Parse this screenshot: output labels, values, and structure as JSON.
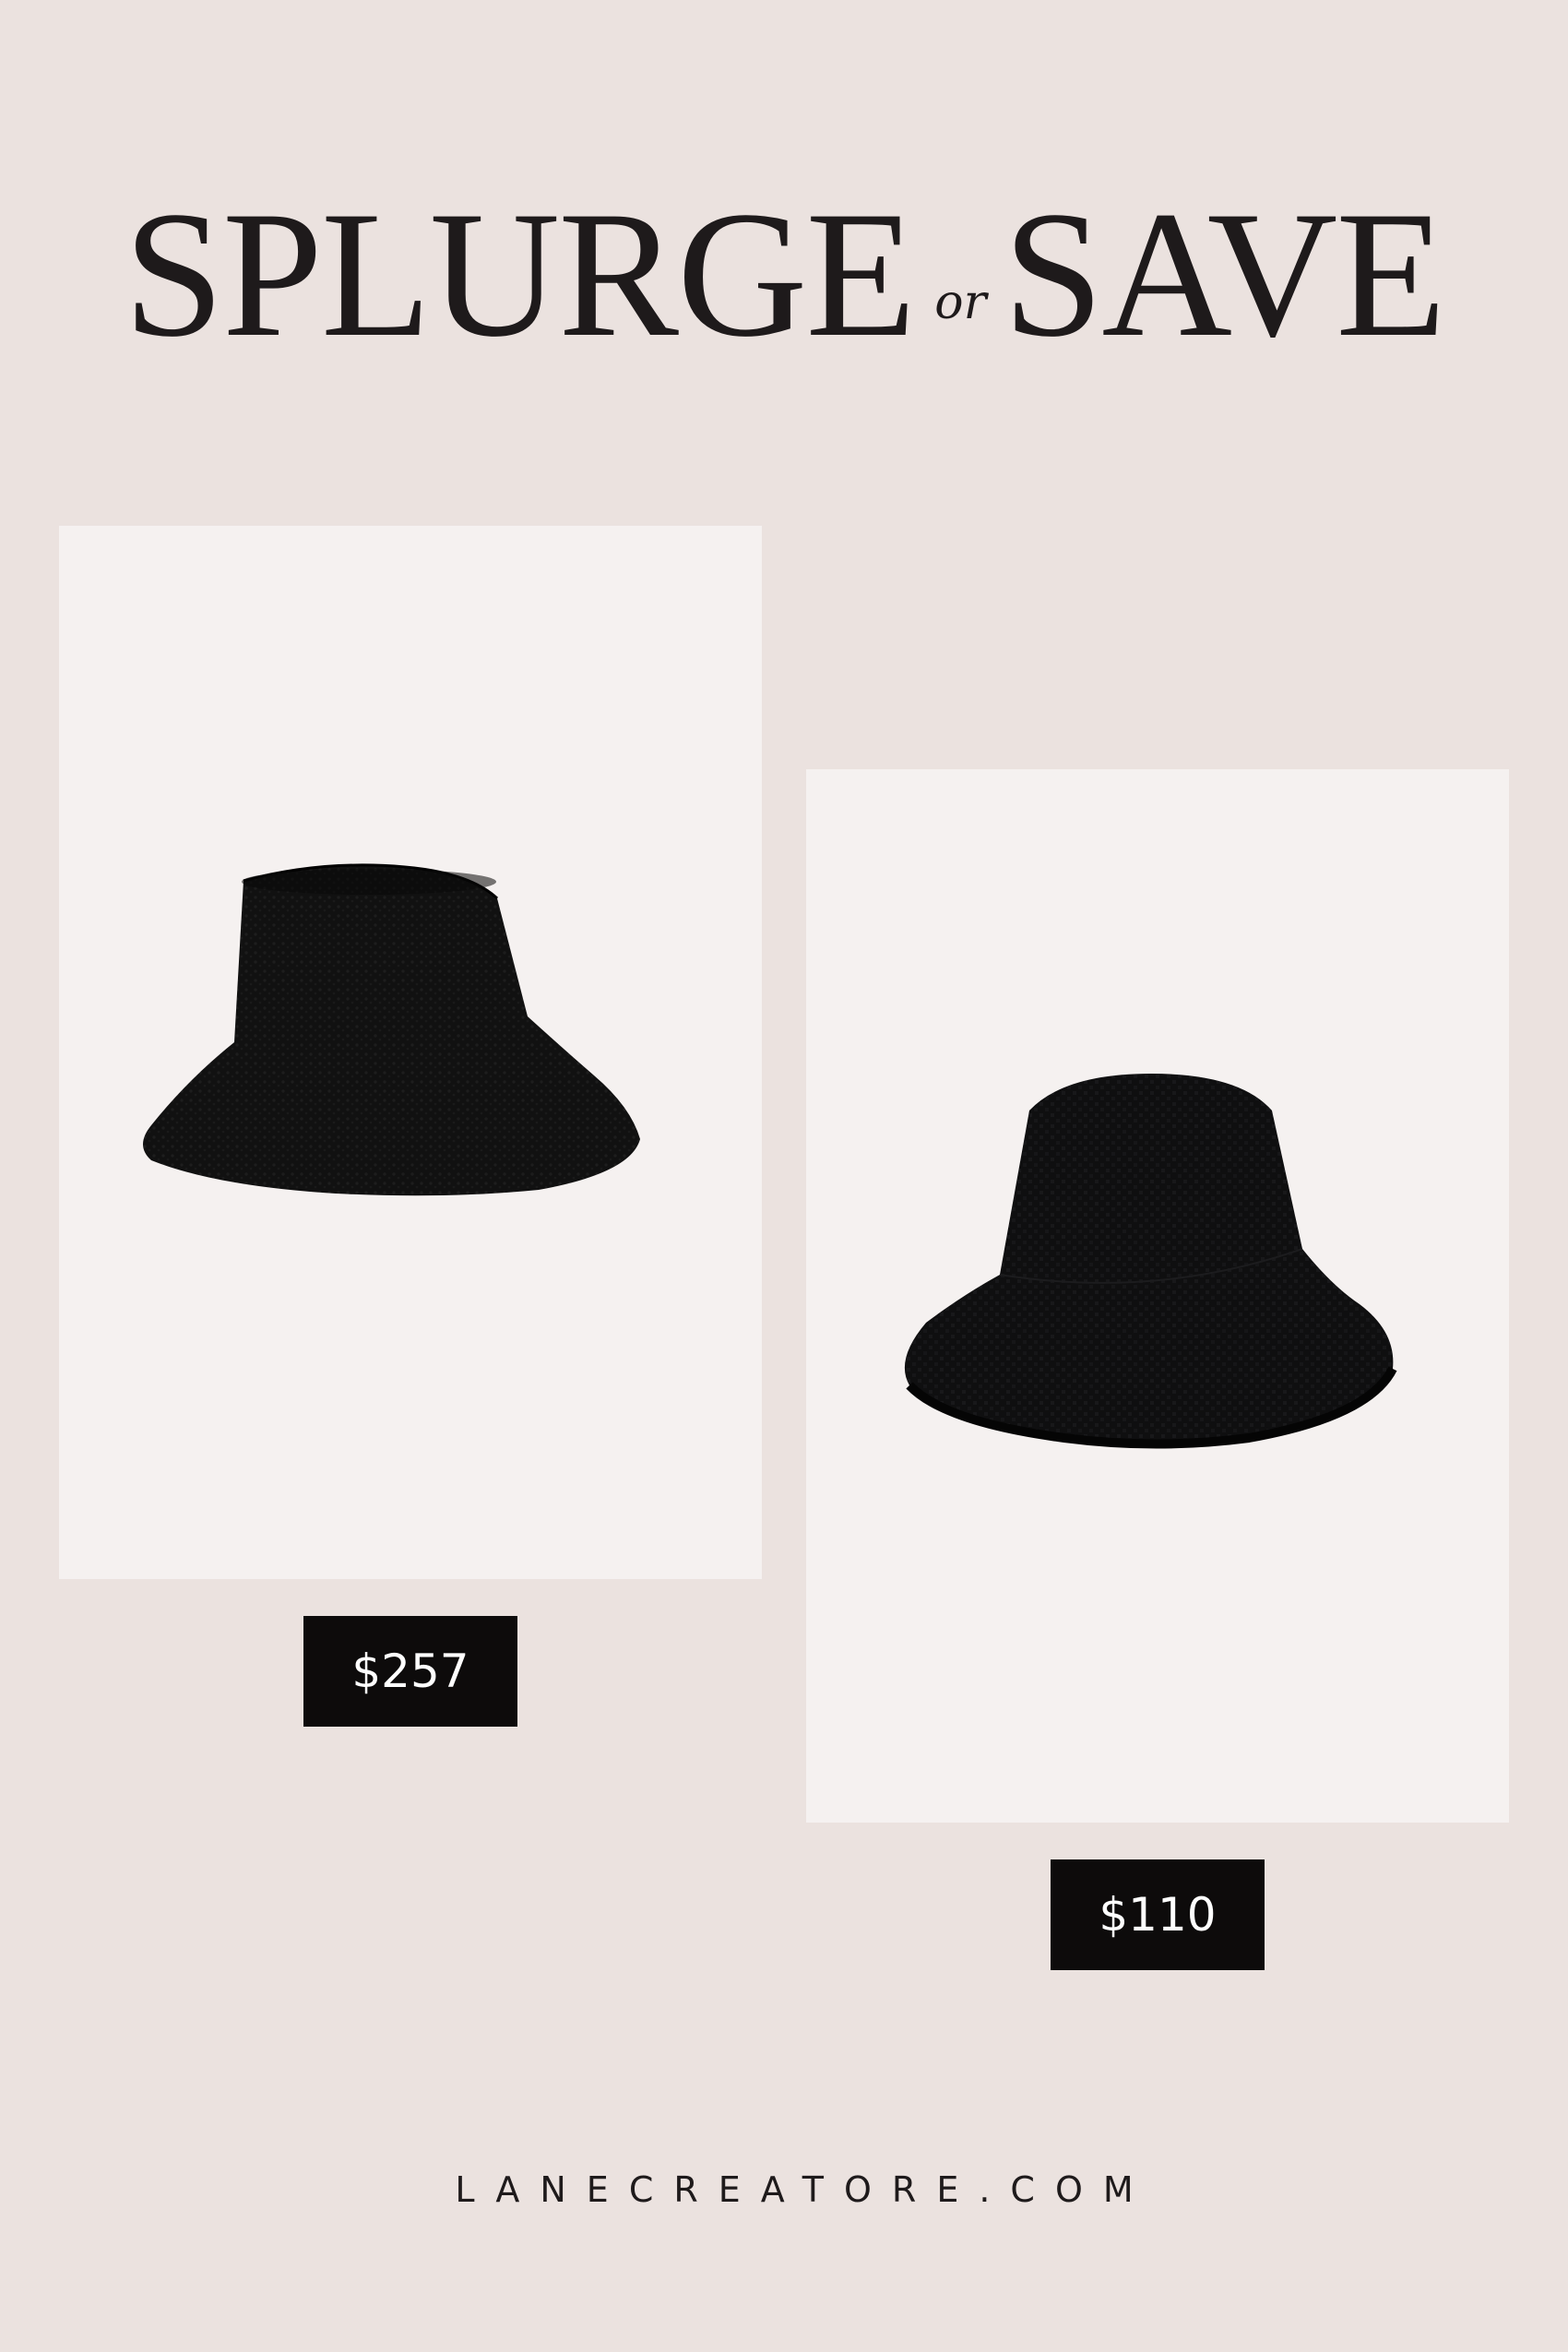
{
  "header": {
    "word_left": "SPLURGE",
    "connector": "or",
    "word_right": "SAVE"
  },
  "products": [
    {
      "price": "$257"
    },
    {
      "price": "$110"
    }
  ],
  "footer": {
    "site": "LANECREATORE.COM"
  },
  "colors": {
    "background": "#ebe2df",
    "card": "#f5f1f0",
    "price_tag": "#0d0b0b",
    "text": "#1e1a1b"
  }
}
